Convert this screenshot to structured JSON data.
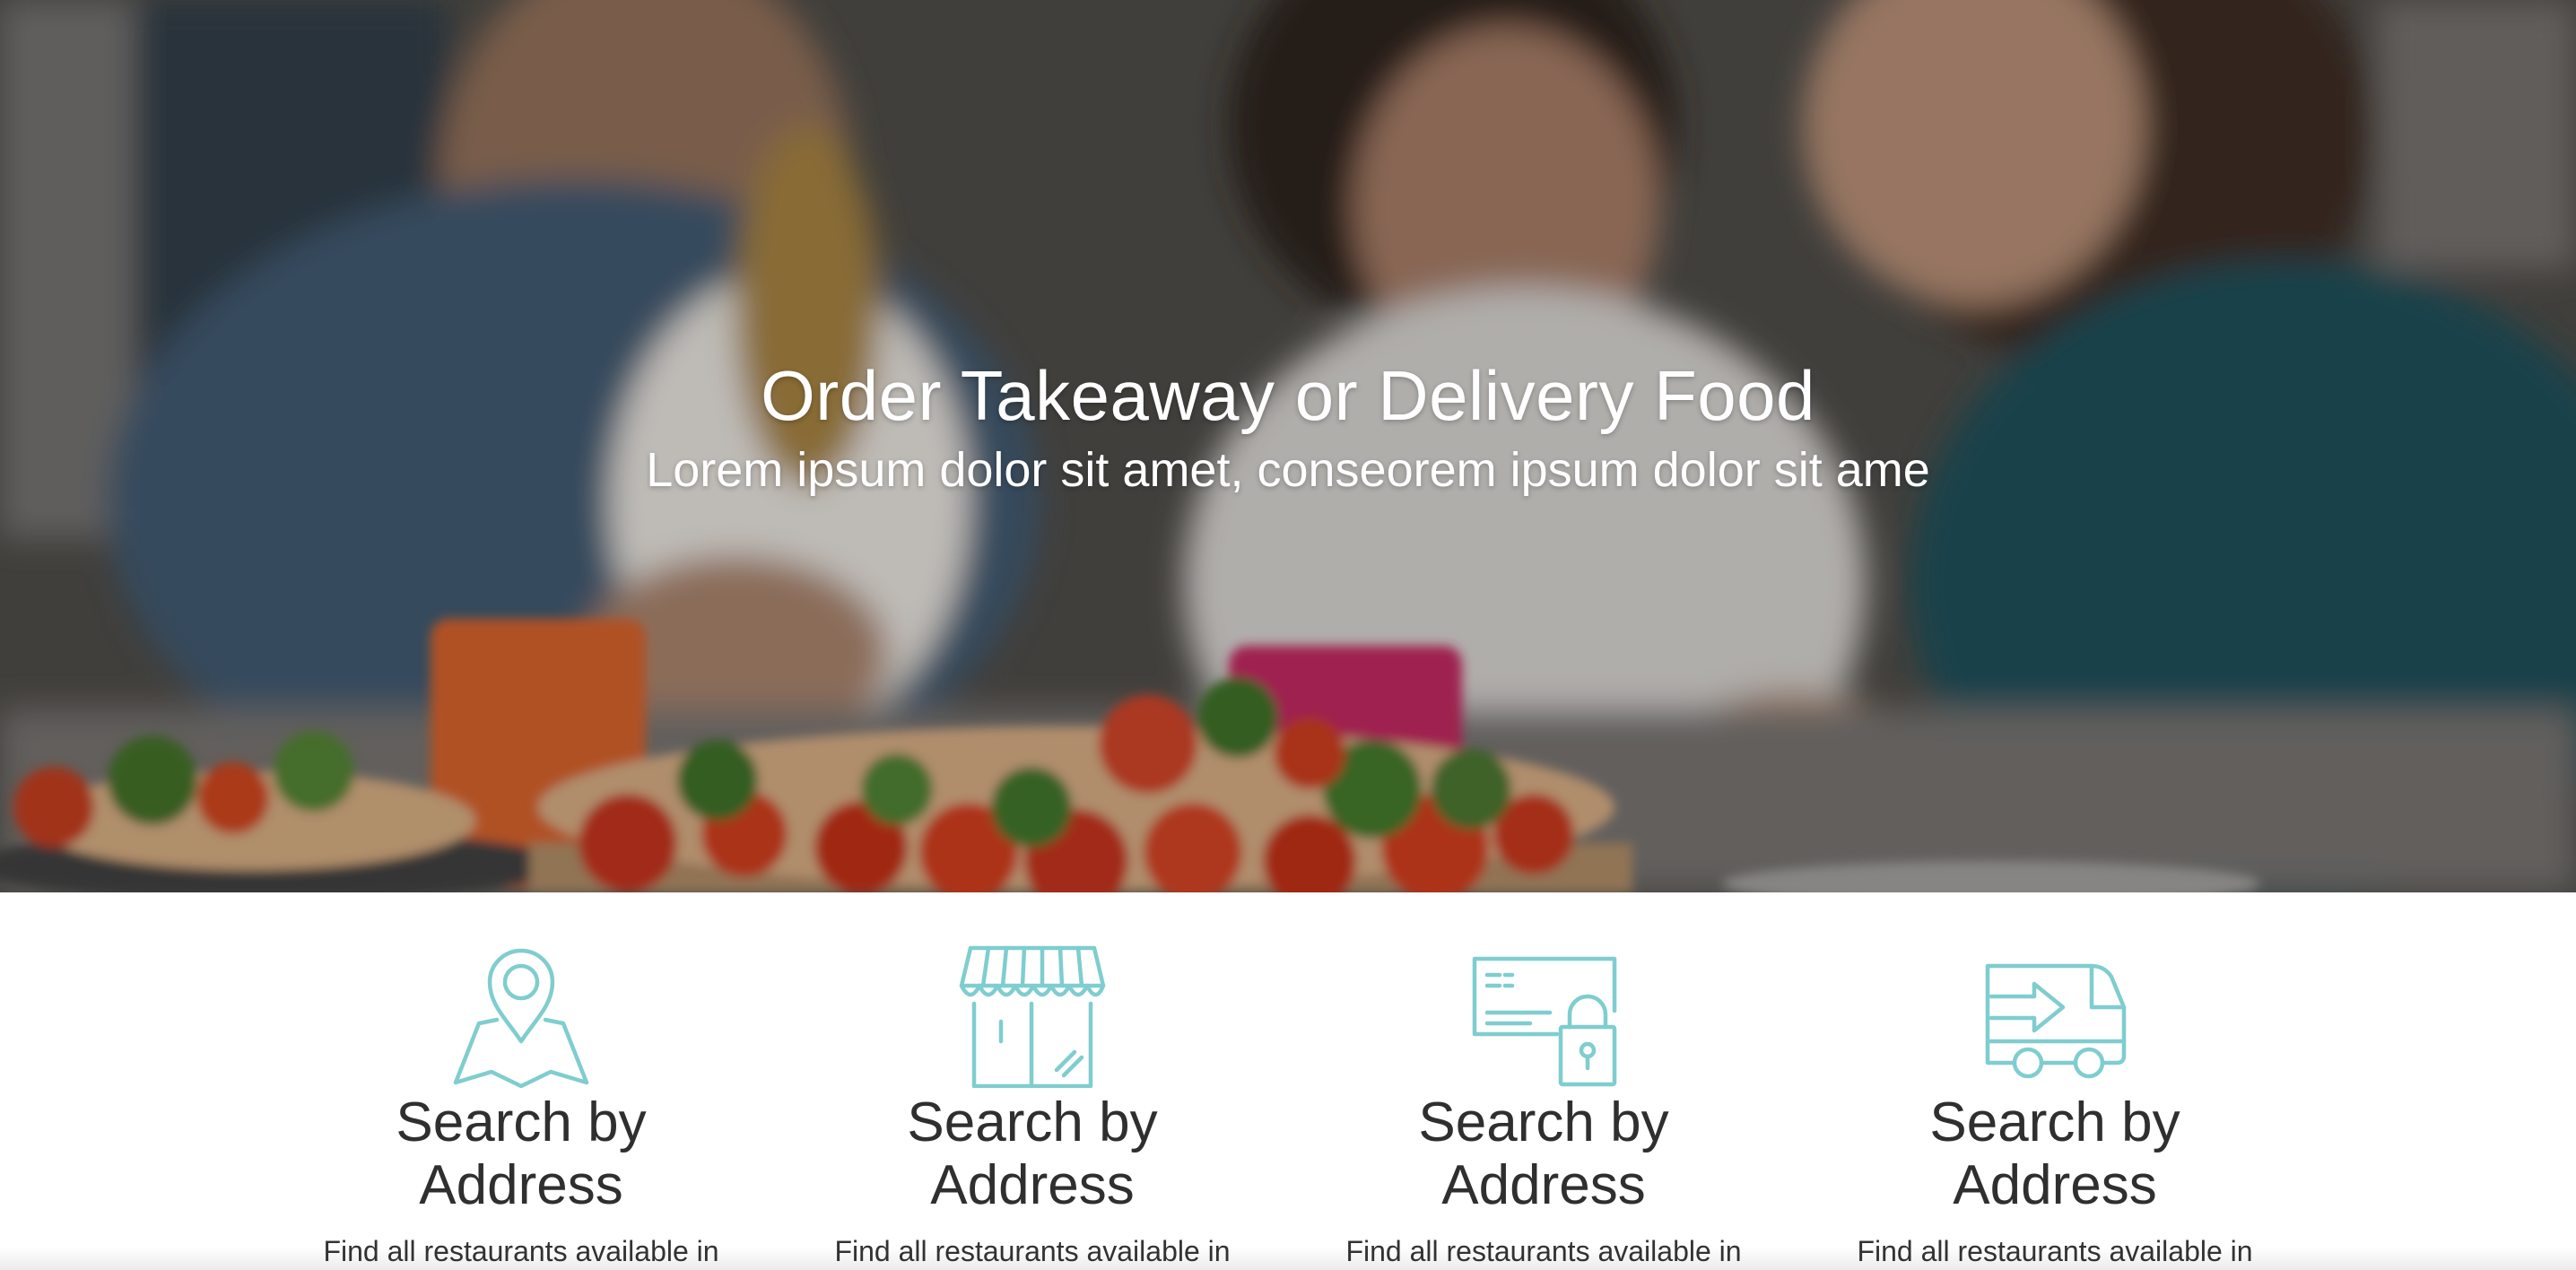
{
  "hero": {
    "title": "Order Takeaway or Delivery Food",
    "subtitle": "Lorem ipsum dolor sit amet, conseorem ipsum dolor sit ame"
  },
  "accent_color": "#7fcdcf",
  "features": [
    {
      "icon": "map-pin-icon",
      "title_line1": "Search by",
      "title_line2": "Address",
      "description": "Find all restaurants available in"
    },
    {
      "icon": "storefront-icon",
      "title_line1": "Search by",
      "title_line2": "Address",
      "description": "Find all restaurants available in"
    },
    {
      "icon": "secure-payment-card-icon",
      "title_line1": "Search by",
      "title_line2": "Address",
      "description": "Find all restaurants available in"
    },
    {
      "icon": "delivery-van-icon",
      "title_line1": "Search by",
      "title_line2": "Address",
      "description": "Find all restaurants available in"
    }
  ]
}
